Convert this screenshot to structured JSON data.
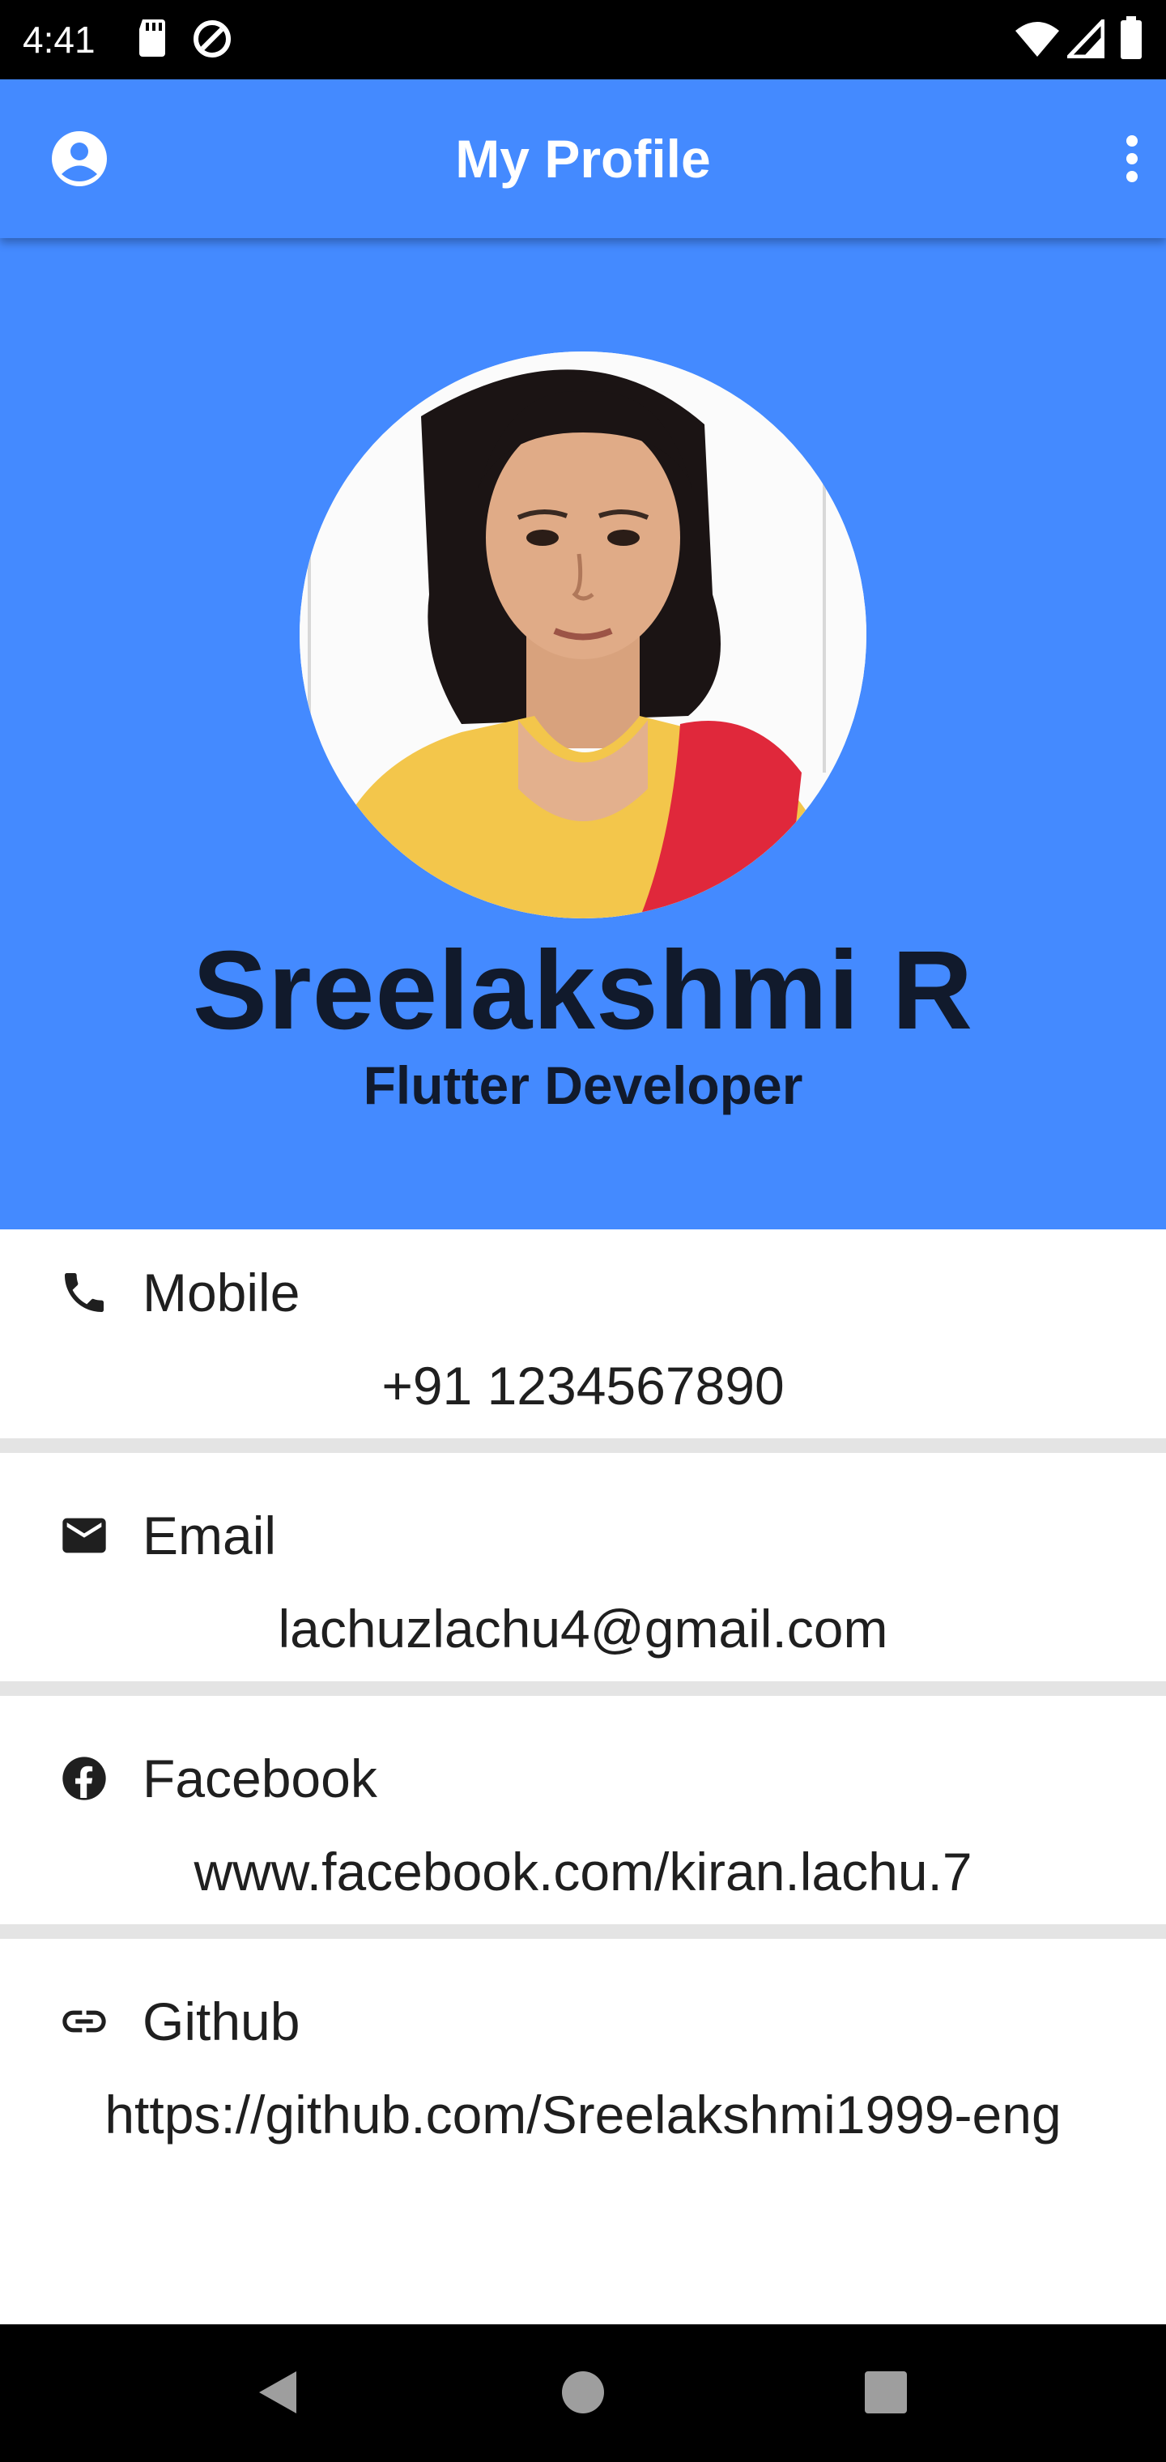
{
  "status_bar": {
    "time": "4:41",
    "icons": [
      "sd-card-icon",
      "data-saver-icon",
      "wifi-icon",
      "cellular-signal-icon",
      "battery-icon"
    ]
  },
  "app_bar": {
    "title": "My Profile",
    "leading_icon": "account-circle-icon",
    "trailing_icon": "more-vert-icon"
  },
  "profile": {
    "name": "Sreelakshmi R",
    "role": "Flutter Developer",
    "avatar": "profile-photo"
  },
  "contacts": [
    {
      "label": "Mobile",
      "value": "+91 1234567890",
      "icon": "phone-icon"
    },
    {
      "label": "Email",
      "value": "lachuzlachu4@gmail.com",
      "icon": "mail-icon"
    },
    {
      "label": "Facebook",
      "value": "www.facebook.com/kiran.lachu.7",
      "icon": "facebook-icon"
    },
    {
      "label": "Github",
      "value": "https://github.com/Sreelakshmi1999-eng",
      "icon": "link-icon"
    }
  ],
  "nav_bar": {
    "buttons": [
      "back-icon",
      "home-icon",
      "recents-icon"
    ]
  },
  "colors": {
    "primary": "#448aff",
    "name_text": "#111a2c",
    "divider": "#e4e4e4",
    "status_bar": "#000000"
  }
}
